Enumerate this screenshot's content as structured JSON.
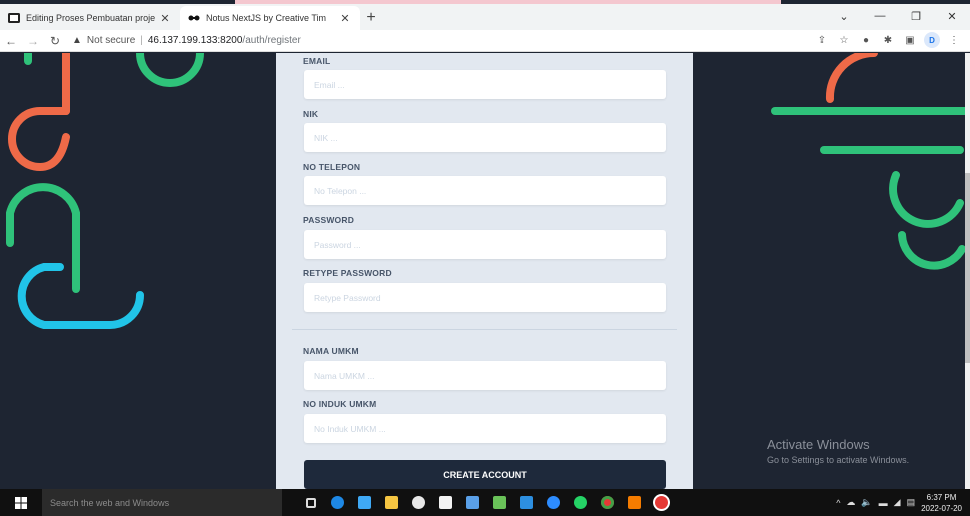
{
  "browser": {
    "tabs": [
      {
        "title": "Editing Proses Pembuatan proje",
        "active": false
      },
      {
        "title": "Notus NextJS by Creative Tim",
        "active": true
      }
    ],
    "new_tab": "+",
    "url_warning": "Not secure",
    "url_host": "46.137.199.133:8200",
    "url_path": "/auth/register",
    "profile_initial": "D"
  },
  "form": {
    "email": {
      "label": "EMAIL",
      "placeholder": "Email ..."
    },
    "nik": {
      "label": "NIK",
      "placeholder": "NIK ..."
    },
    "phone": {
      "label": "NO TELEPON",
      "placeholder": "No Telepon ..."
    },
    "password": {
      "label": "PASSWORD",
      "placeholder": "Password ..."
    },
    "retype": {
      "label": "RETYPE PASSWORD",
      "placeholder": "Retype Password"
    },
    "umkm_name": {
      "label": "NAMA UMKM",
      "placeholder": "Nama UMKM ..."
    },
    "umkm_id": {
      "label": "NO INDUK UMKM",
      "placeholder": "No Induk UMKM ..."
    },
    "submit": "CREATE ACCOUNT"
  },
  "watermark": {
    "line1": "Activate Windows",
    "line2": "Go to Settings to activate Windows."
  },
  "taskbar": {
    "search_placeholder": "Search the web and Windows",
    "time": "6:37 PM",
    "date": "2022-07-20"
  },
  "colors": {
    "page_bg": "#1e2532",
    "card_bg": "#e2e8f0",
    "button_bg": "#1e293b",
    "deco_orange": "#ef6a48",
    "deco_green": "#2fc27a",
    "deco_cyan": "#21c4e8"
  }
}
